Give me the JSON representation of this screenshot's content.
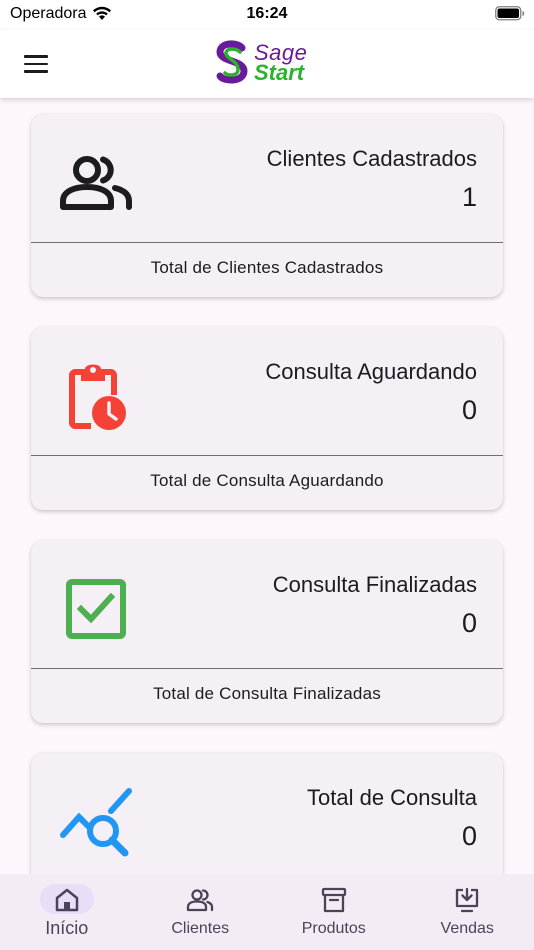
{
  "status_bar": {
    "carrier": "Operadora",
    "time": "16:24"
  },
  "app_bar": {
    "logo_line1": "Sage",
    "logo_line2": "Start",
    "colors": {
      "logo_purple": "#6a1b9a",
      "logo_green": "#2db22d"
    }
  },
  "cards": [
    {
      "title": "Clientes Cadastrados",
      "value": "1",
      "footer": "Total de Clientes Cadastrados",
      "icon": "people-icon",
      "icon_color": "#1d1b20"
    },
    {
      "title": "Consulta Aguardando",
      "value": "0",
      "footer": "Total de Consulta Aguardando",
      "icon": "clipboard-clock-icon",
      "icon_color": "#f44336"
    },
    {
      "title": "Consulta Finalizadas",
      "value": "0",
      "footer": "Total de Consulta Finalizadas",
      "icon": "checkbox-checked-icon",
      "icon_color": "#4caf50"
    },
    {
      "title": "Total de Consulta",
      "value": "0",
      "footer": "",
      "icon": "trend-search-icon",
      "icon_color": "#2196f3"
    }
  ],
  "bottom_nav": {
    "items": [
      {
        "label": "Início",
        "icon": "home-icon",
        "active": true
      },
      {
        "label": "Clientes",
        "icon": "people-icon",
        "active": false
      },
      {
        "label": "Produtos",
        "icon": "archive-icon",
        "active": false
      },
      {
        "label": "Vendas",
        "icon": "download-desktop-icon",
        "active": false
      }
    ]
  }
}
